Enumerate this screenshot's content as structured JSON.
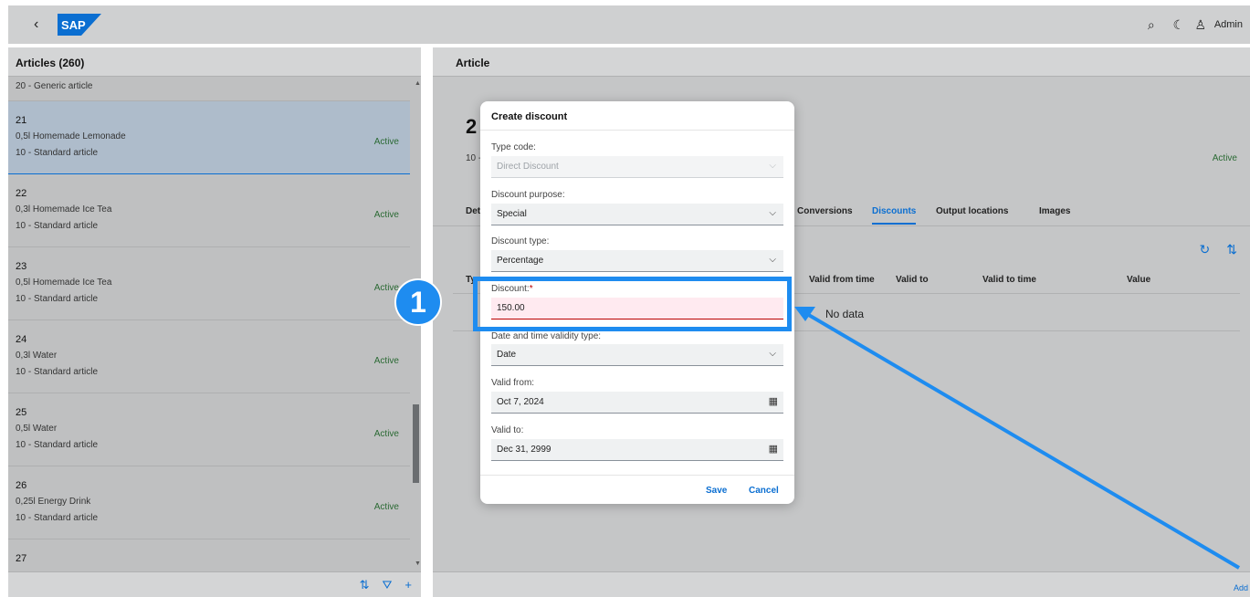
{
  "shell": {
    "logo_text": "SAP",
    "user_label": "Admin"
  },
  "master": {
    "title": "Articles (260)",
    "first_row": "20 - Generic article",
    "items": [
      {
        "num": "21",
        "name": "0,5l Homemade Lemonade",
        "type": "10 - Standard article",
        "status": "Active"
      },
      {
        "num": "22",
        "name": "0,3l Homemade Ice Tea",
        "type": "10 - Standard article",
        "status": "Active"
      },
      {
        "num": "23",
        "name": "0,5l Homemade Ice Tea",
        "type": "10 - Standard article",
        "status": "Active"
      },
      {
        "num": "24",
        "name": "0,3l Water",
        "type": "10 - Standard article",
        "status": "Active"
      },
      {
        "num": "25",
        "name": "0,5l Water",
        "type": "10 - Standard article",
        "status": "Active"
      },
      {
        "num": "26",
        "name": "0,25l Energy Drink",
        "type": "10 - Standard article",
        "status": "Active"
      },
      {
        "num": "27",
        "name": "",
        "type": "",
        "status": ""
      }
    ]
  },
  "detail": {
    "title": "Article",
    "object_title_partial": "2",
    "object_subtitle_partial": "10 -",
    "object_status": "Active",
    "tabs": {
      "details_partial": "Det",
      "conversions": "Conversions",
      "discounts": "Discounts",
      "output_locations": "Output locations",
      "images": "Images"
    },
    "table": {
      "col_type_partial": "Ty",
      "col_valid_from_time": "Valid from time",
      "col_valid_to": "Valid to",
      "col_valid_to_time": "Valid to time",
      "col_value": "Value",
      "no_data": "No data"
    },
    "footer_add": "Add"
  },
  "dialog": {
    "title": "Create discount",
    "type_code_label": "Type code:",
    "type_code_value": "Direct Discount",
    "purpose_label": "Discount purpose:",
    "purpose_value": "Special",
    "discount_type_label": "Discount type:",
    "discount_type_value": "Percentage",
    "discount_label": "Discount:",
    "discount_required": "*",
    "discount_value": "150.00",
    "validity_type_label": "Date and time validity type:",
    "validity_type_value": "Date",
    "valid_from_label": "Valid from:",
    "valid_from_value": "Oct 7, 2024",
    "valid_to_label": "Valid to:",
    "valid_to_value": "Dec 31, 2999",
    "save_label": "Save",
    "cancel_label": "Cancel"
  },
  "annotation": {
    "step_number": "1",
    "color": "#1e8cf0"
  },
  "icons": {
    "back": "‹",
    "search": "⌕",
    "theme": "☾",
    "user": "♙",
    "sort": "⇅",
    "filter": "⛛",
    "add": "+",
    "refresh": "↻",
    "chevron": "⌵",
    "calendar": "▦"
  }
}
